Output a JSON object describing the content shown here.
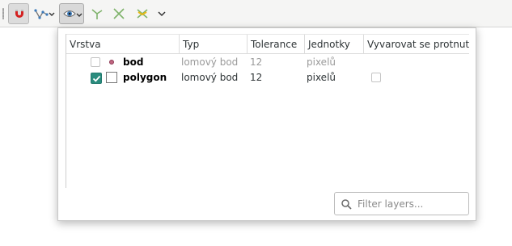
{
  "toolbar": {
    "buttons": [
      {
        "name": "snapping-magnet-icon"
      },
      {
        "name": "layer-selection-icon"
      },
      {
        "name": "snap-config-eye-icon"
      },
      {
        "name": "topological-editing-icon"
      },
      {
        "name": "snap-on-intersection-icon"
      },
      {
        "name": "self-snapping-icon"
      },
      {
        "name": "more-chevron-icon"
      }
    ]
  },
  "table": {
    "columns": [
      "Vrstva",
      "Typ",
      "Tolerance",
      "Jednotky",
      "Vyvarovat se protnutí"
    ],
    "rows": [
      {
        "layer": "bod",
        "type": "lomový bod",
        "tolerance": "12",
        "units": "pixelů",
        "enabled": false,
        "avoid_intersection": null
      },
      {
        "layer": "polygon",
        "type": "lomový bod",
        "tolerance": "12",
        "units": "pixelů",
        "enabled": true,
        "avoid_intersection": false
      }
    ]
  },
  "filter": {
    "placeholder": "Filter layers...",
    "value": ""
  },
  "colors": {
    "accent_check": "#2a8c7e",
    "point_symbol": "#c06580"
  }
}
